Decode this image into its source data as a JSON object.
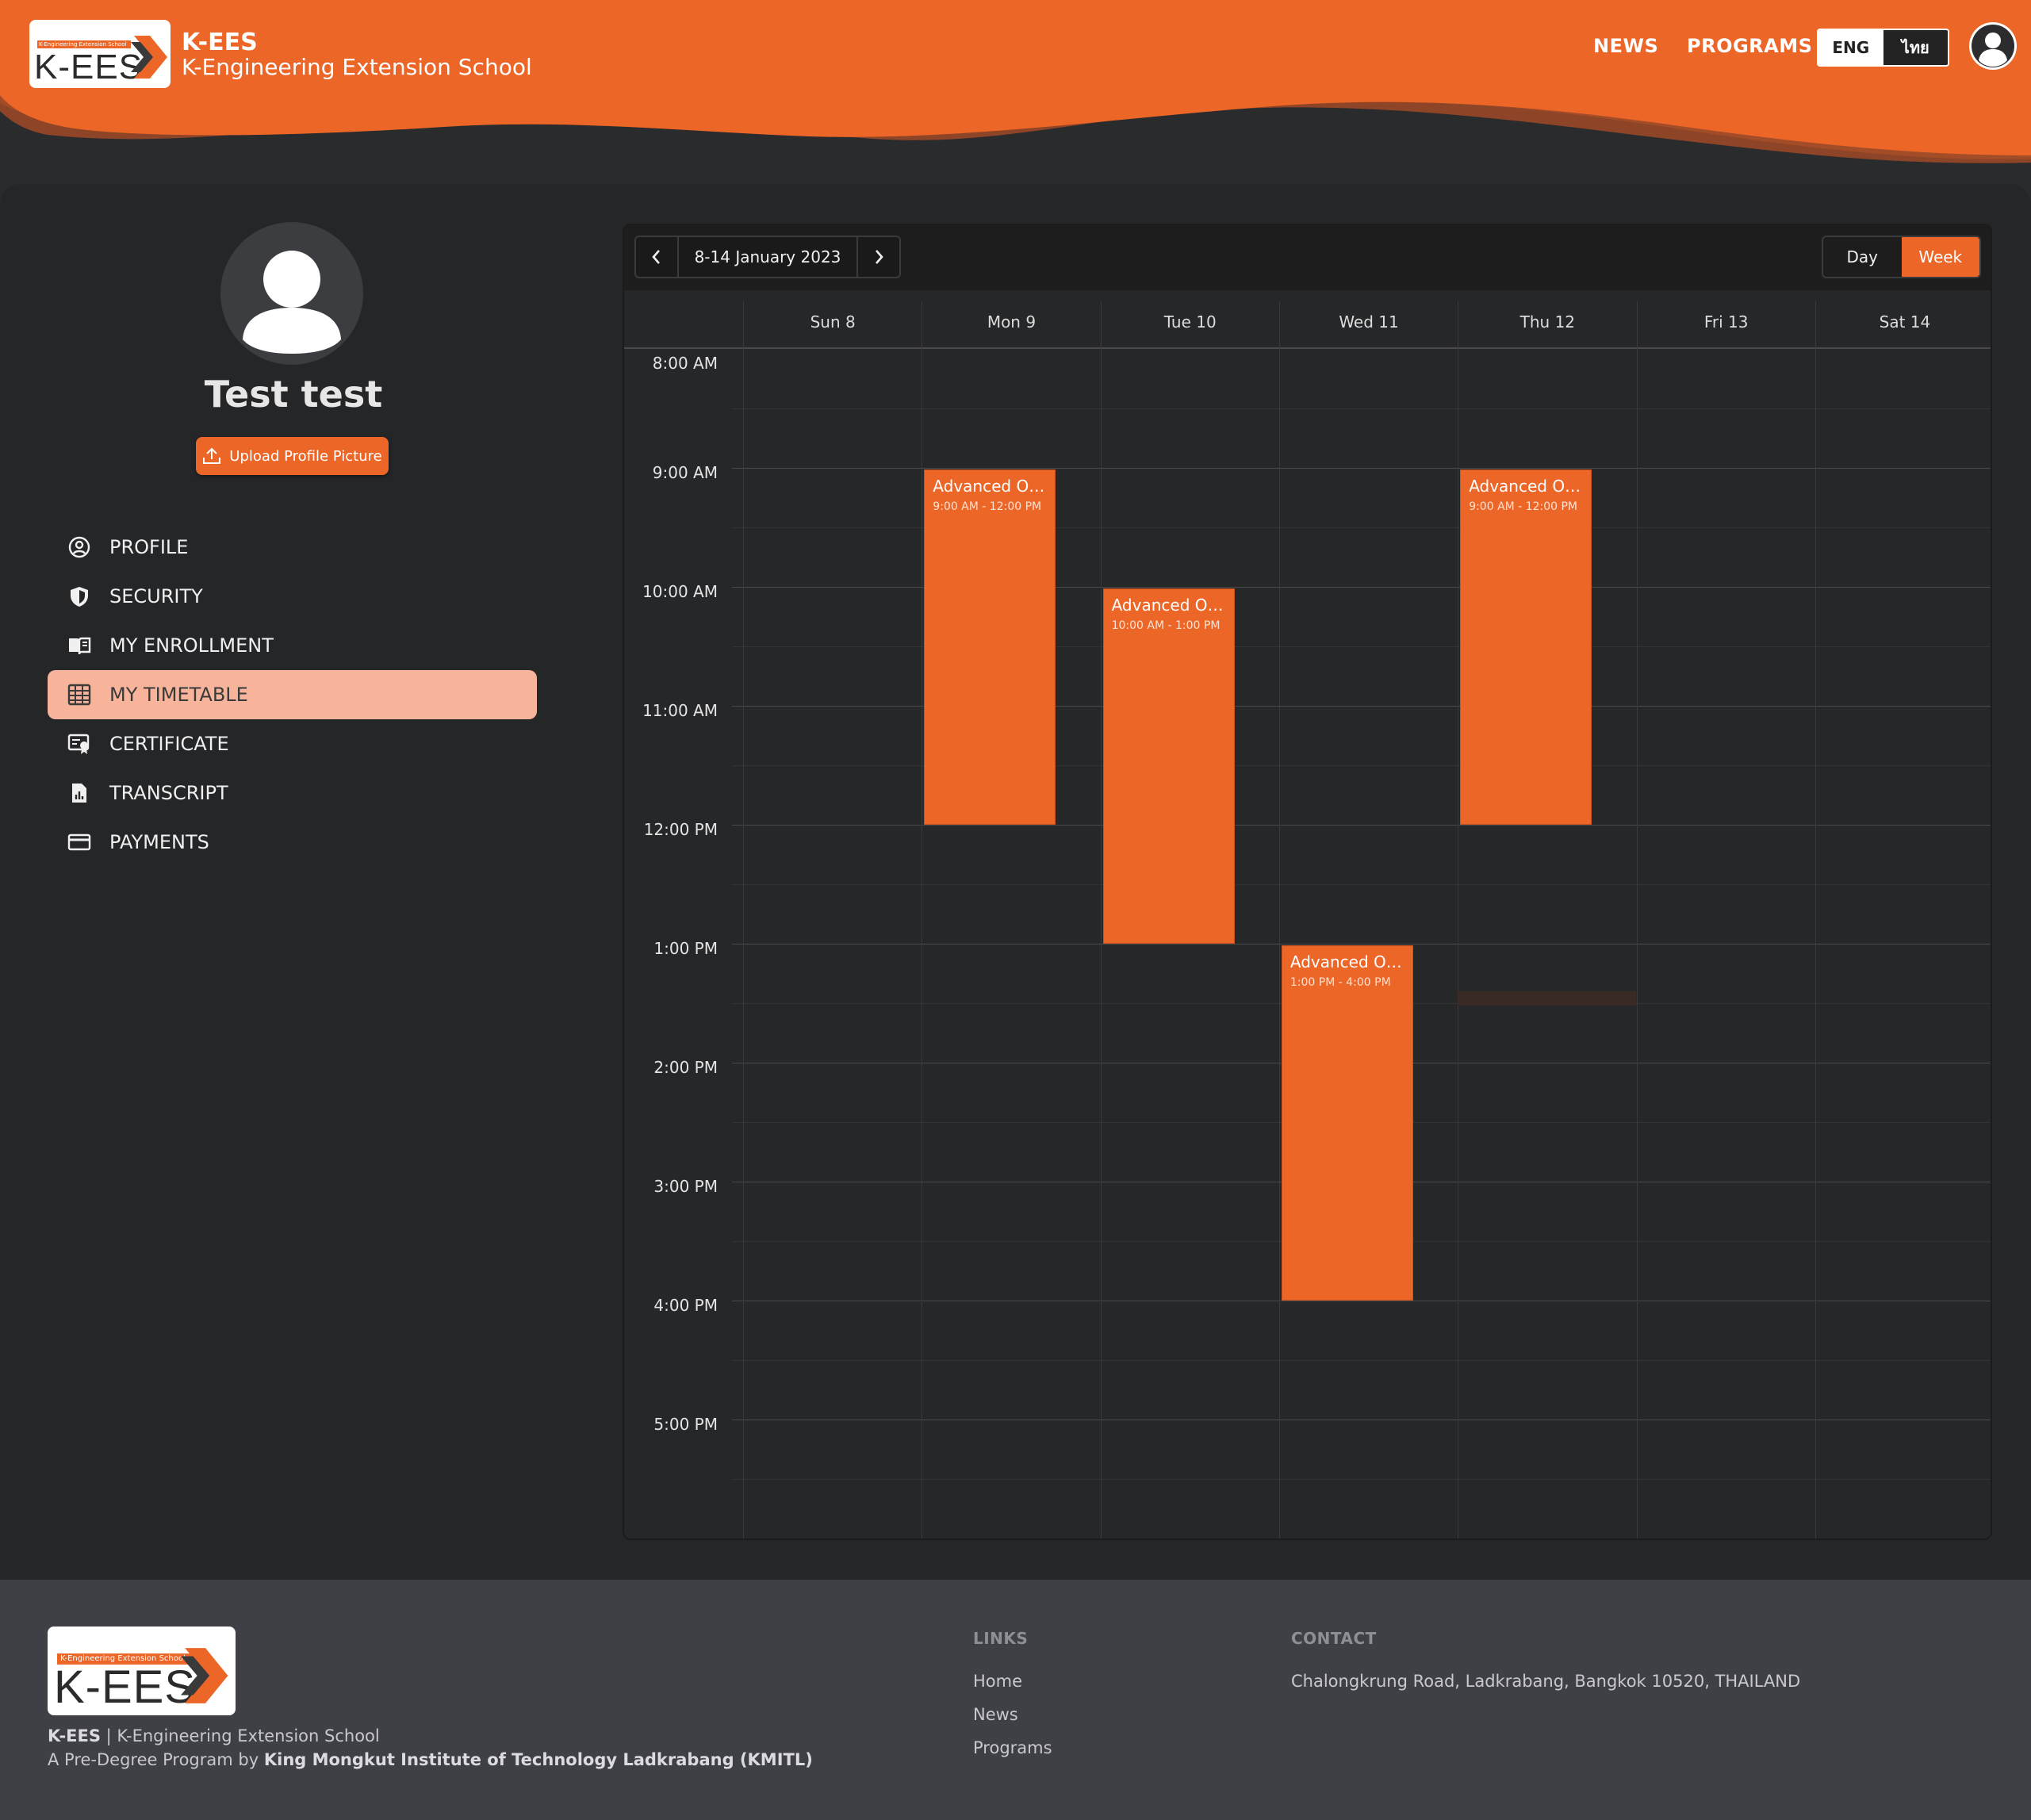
{
  "header": {
    "logo_strip": "K-Engineering Extension School",
    "logo_mark": "K-EES",
    "brand_title": "K-EES",
    "brand_subtitle": "K-Engineering Extension School",
    "nav": [
      {
        "label": "NEWS"
      },
      {
        "label": "PROGRAMS"
      }
    ],
    "lang": {
      "eng": "ENG",
      "thai": "ไทย",
      "selected": "ENG"
    },
    "accent_color": "#ec6628"
  },
  "profile": {
    "name": "Test test",
    "upload_label": "Upload Profile Picture"
  },
  "sidebar": {
    "items": [
      {
        "label": "PROFILE",
        "icon": "user-circle-icon",
        "active": false
      },
      {
        "label": "SECURITY",
        "icon": "shield-icon",
        "active": false
      },
      {
        "label": "MY ENROLLMENT",
        "icon": "book-icon",
        "active": false
      },
      {
        "label": "MY TIMETABLE",
        "icon": "table-icon",
        "active": true
      },
      {
        "label": "CERTIFICATE",
        "icon": "certificate-icon",
        "active": false
      },
      {
        "label": "TRANSCRIPT",
        "icon": "transcript-icon",
        "active": false
      },
      {
        "label": "PAYMENTS",
        "icon": "card-icon",
        "active": false
      }
    ]
  },
  "calendar": {
    "range_label": "8-14 January 2023",
    "views": {
      "day": "Day",
      "week": "Week",
      "selected": "Week"
    },
    "days": [
      "Sun 8",
      "Mon 9",
      "Tue 10",
      "Wed 11",
      "Thu 12",
      "Fri 13",
      "Sat 14"
    ],
    "hours": [
      "8:00 AM",
      "9:00 AM",
      "10:00 AM",
      "11:00 AM",
      "12:00 PM",
      "1:00 PM",
      "2:00 PM",
      "3:00 PM",
      "4:00 PM",
      "5:00 PM"
    ],
    "events": [
      {
        "day": 1,
        "start": 9,
        "end": 12,
        "title": "Advanced Op...",
        "time": "9:00 AM - 12:00 PM"
      },
      {
        "day": 2,
        "start": 10,
        "end": 13,
        "title": "Advanced Op...",
        "time": "10:00 AM - 1:00 PM"
      },
      {
        "day": 3,
        "start": 13,
        "end": 16,
        "title": "Advanced Op...",
        "time": "1:00 PM - 4:00 PM"
      },
      {
        "day": 4,
        "start": 9,
        "end": 12,
        "title": "Advanced Op...",
        "time": "9:00 AM - 12:00 PM"
      }
    ],
    "current_time_marker": {
      "day": 4,
      "hour": 13.4
    }
  },
  "footer": {
    "logo_strip": "K-Engineering Extension School",
    "logo_mark": "K-EES",
    "brand_short": "K-EES",
    "brand_full": "K-Engineering Extension School",
    "tagline_prefix": "A Pre-Degree Program by",
    "tagline_org": "King Mongkut Institute of Technology Ladkrabang (KMITL)",
    "links_heading": "LINKS",
    "links": [
      "Home",
      "News",
      "Programs"
    ],
    "contact_heading": "CONTACT",
    "contact_address": "Chalongkrung Road, Ladkrabang, Bangkok 10520, THAILAND"
  }
}
